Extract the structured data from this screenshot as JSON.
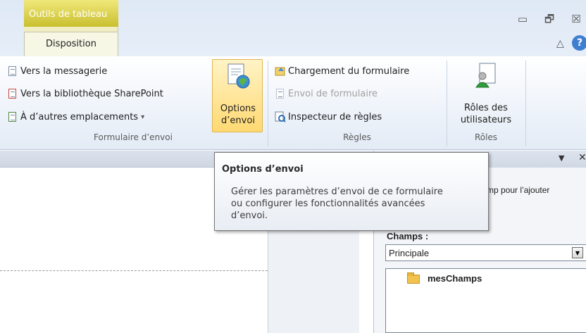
{
  "window": {
    "context_tab_group": "Outils de tableau",
    "active_tab": "Disposition",
    "minimize_glyph": "▭",
    "restore_glyph": "🗗",
    "close_glyph": "☒",
    "collapse_glyph": "△",
    "help_glyph": "?"
  },
  "ribbon": {
    "groups": {
      "formulaire_envoi": {
        "label": "Formulaire d’envoi",
        "items": {
          "messagerie": "Vers la messagerie",
          "sharepoint": "Vers la bibliothèque SharePoint",
          "autres": "À d’autres emplacements",
          "autres_arrow": "▾"
        },
        "options_line1": "Options",
        "options_line2": "d’envoi"
      },
      "regles": {
        "label": "Règles",
        "items": {
          "chargement": "Chargement du formulaire",
          "envoi": "Envoi de formulaire",
          "inspecteur": "Inspecteur de règles"
        }
      },
      "roles": {
        "label": "Rôles",
        "button_line1": "Rôles des",
        "button_line2": "utilisateurs"
      }
    }
  },
  "tooltip": {
    "title": "Options d’envoi",
    "line1": "Gérer les paramètres d’envoi de ce formulaire",
    "line2": "ou configurer les fonctionnalités avancées",
    "line3": "d’envoi."
  },
  "taskpane": {
    "arrow_glyph": "▼",
    "close_glyph": "✕",
    "instruction_fragment": "mp pour l’ajouter",
    "champs_label": "Champs :",
    "select_value": "Principale",
    "select_arrow": "▼",
    "tree_root": "mesChamps"
  },
  "colors": {
    "context_tab": "#d6c93a",
    "selected_button": "#ffd972",
    "help_icon": "#3f7fd0"
  }
}
